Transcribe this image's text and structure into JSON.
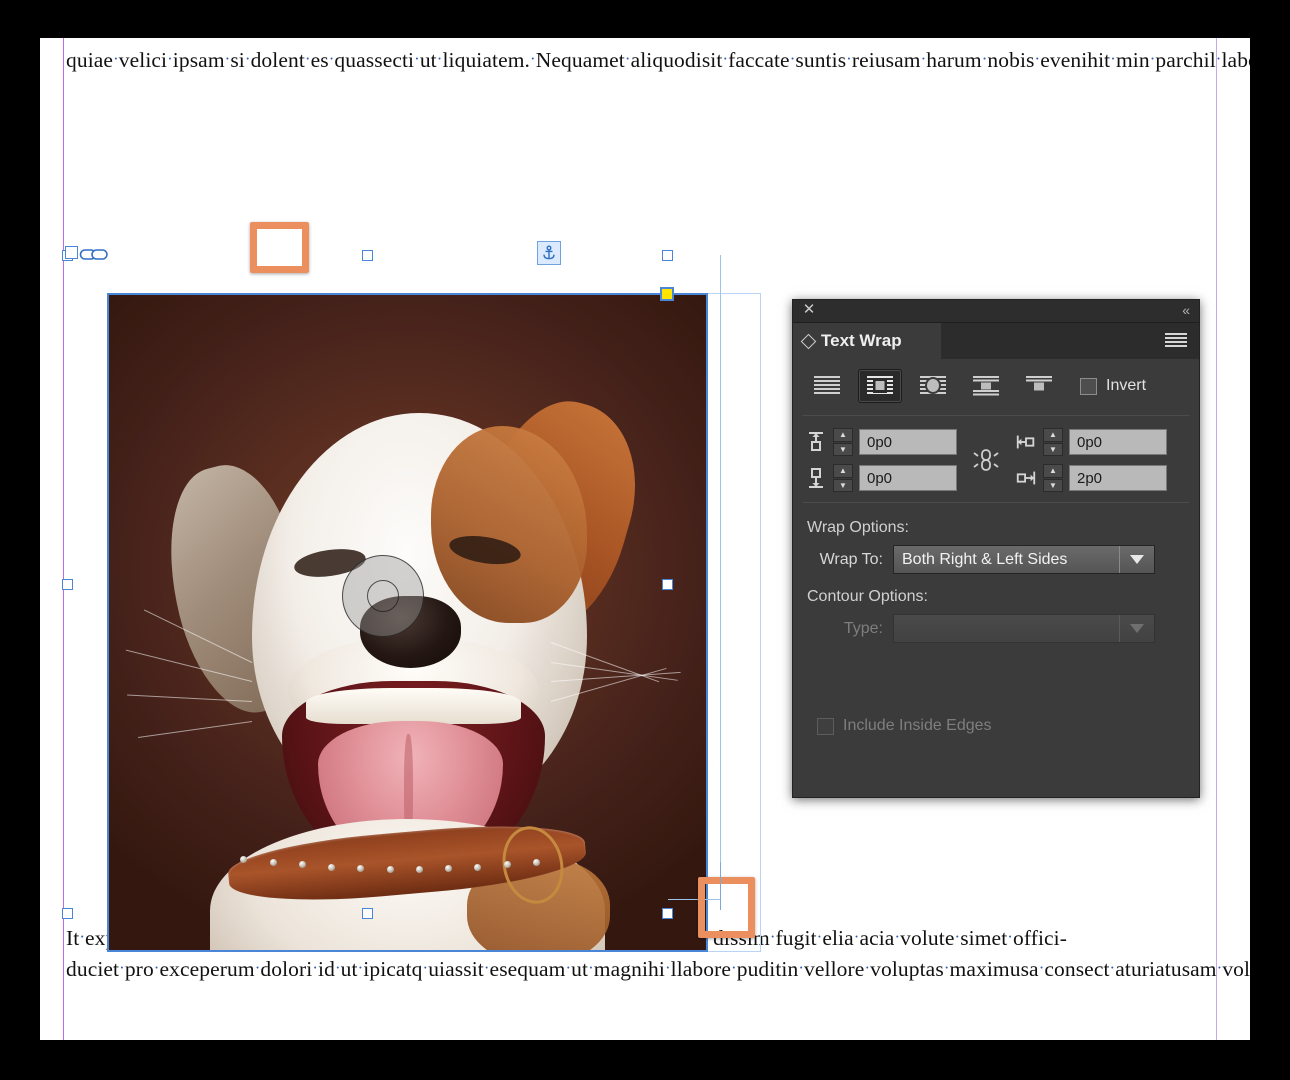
{
  "document": {
    "story_top": "quiae velici ipsam si dolent es quassecti ut liquiatem. Nequamet aliquodisit faccate suntis reiusam harum nobis evenihit min parchil labora aut lamus cor ad es dessed et aut od quam dolorem volessed quas dolenimus re ped quis et quibusam voluptiae vent optatur reped erionse quatus endem sam doluptur, eos minciis dolupturiae alitis re pratent arciend istio. It labore magnat et eatis ea velloribus dita di volecta dolupti ut pre porrum ent dolore perecti ossimagnim qui restotatis ut ut aliae nus experum dunt acient aditatur alit quis dolorum accuptam simus, sant a custrupid eic te nima que pliquod ignihillam, explabo. Et del maio venim utem quiae ex exerore mpedis denda que pliquis at.",
    "story_bottom": "It explis acidelibus pliae etusam ipit harupisciae dia volupta ssequae nusa dissim fugit elia acia volute simet offici-duciet pro exceperum dolori id ut ipicatq uiassit esequam ut magnihi llabore puditin vellore voluptas maximusa consect aturiatusam volore necest dellanianti voloruptio optat fugias molupid exceatus dolumqui simusciendi ipsam lic torion res dem entes est, alite nonsenis quo mo il im voloria epudae plique pratet eossuntior sus dolo-",
    "pilcrow_glyph": "¶",
    "anchor_icon": "anchor-icon",
    "link_icon": "link-chain-icon"
  },
  "panel": {
    "title": "Text Wrap",
    "close_glyph": "✕",
    "collapse_glyph": "«",
    "menu_icon": "panel-menu-icon",
    "tab_diamond_icon": "diamond-icon",
    "modes": [
      {
        "name": "no-text-wrap",
        "label": "No text wrap",
        "selected": false
      },
      {
        "name": "wrap-around-bounding-box",
        "label": "Wrap around bounding box",
        "selected": true
      },
      {
        "name": "wrap-around-object-shape",
        "label": "Wrap around object shape",
        "selected": false
      },
      {
        "name": "jump-object",
        "label": "Jump object",
        "selected": false
      },
      {
        "name": "jump-to-next-column",
        "label": "Jump to next column",
        "selected": false
      }
    ],
    "invert_label": "Invert",
    "invert_checked": false,
    "offsets": {
      "top": {
        "icon": "offset-top-icon",
        "value": "0p0"
      },
      "bottom": {
        "icon": "offset-bottom-icon",
        "value": "0p0"
      },
      "left": {
        "icon": "offset-left-icon",
        "value": "0p0"
      },
      "right": {
        "icon": "offset-right-icon",
        "value": "2p0"
      },
      "link_icon": "broken-chain-icon",
      "link_state": "unlinked"
    },
    "wrap_options_label": "Wrap Options:",
    "wrap_to_label": "Wrap To:",
    "wrap_to_value": "Both Right & Left Sides",
    "contour_options_label": "Contour Options:",
    "type_label": "Type:",
    "type_value": "",
    "type_disabled": true,
    "include_inside_edges_label": "Include Inside Edges",
    "include_inside_edges_checked": false,
    "include_inside_edges_disabled": true
  },
  "colors": {
    "panel_bg": "#3b3b3b",
    "panel_titlebar": "#2d2d2d",
    "selection_blue": "#4a86d8",
    "wrap_boundary": "#b9d4f4",
    "corner_handle_yellow": "#ffe400",
    "highlight_orange": "#eb8f5e",
    "margin_guide_purple": "#c06ce0",
    "pilcrow_blue": "#3b7ddd"
  },
  "annotations": {
    "highlight_1_name": "highlight-box-paragraph-mark-top",
    "highlight_2_name": "highlight-box-paragraph-mark-bottom"
  }
}
